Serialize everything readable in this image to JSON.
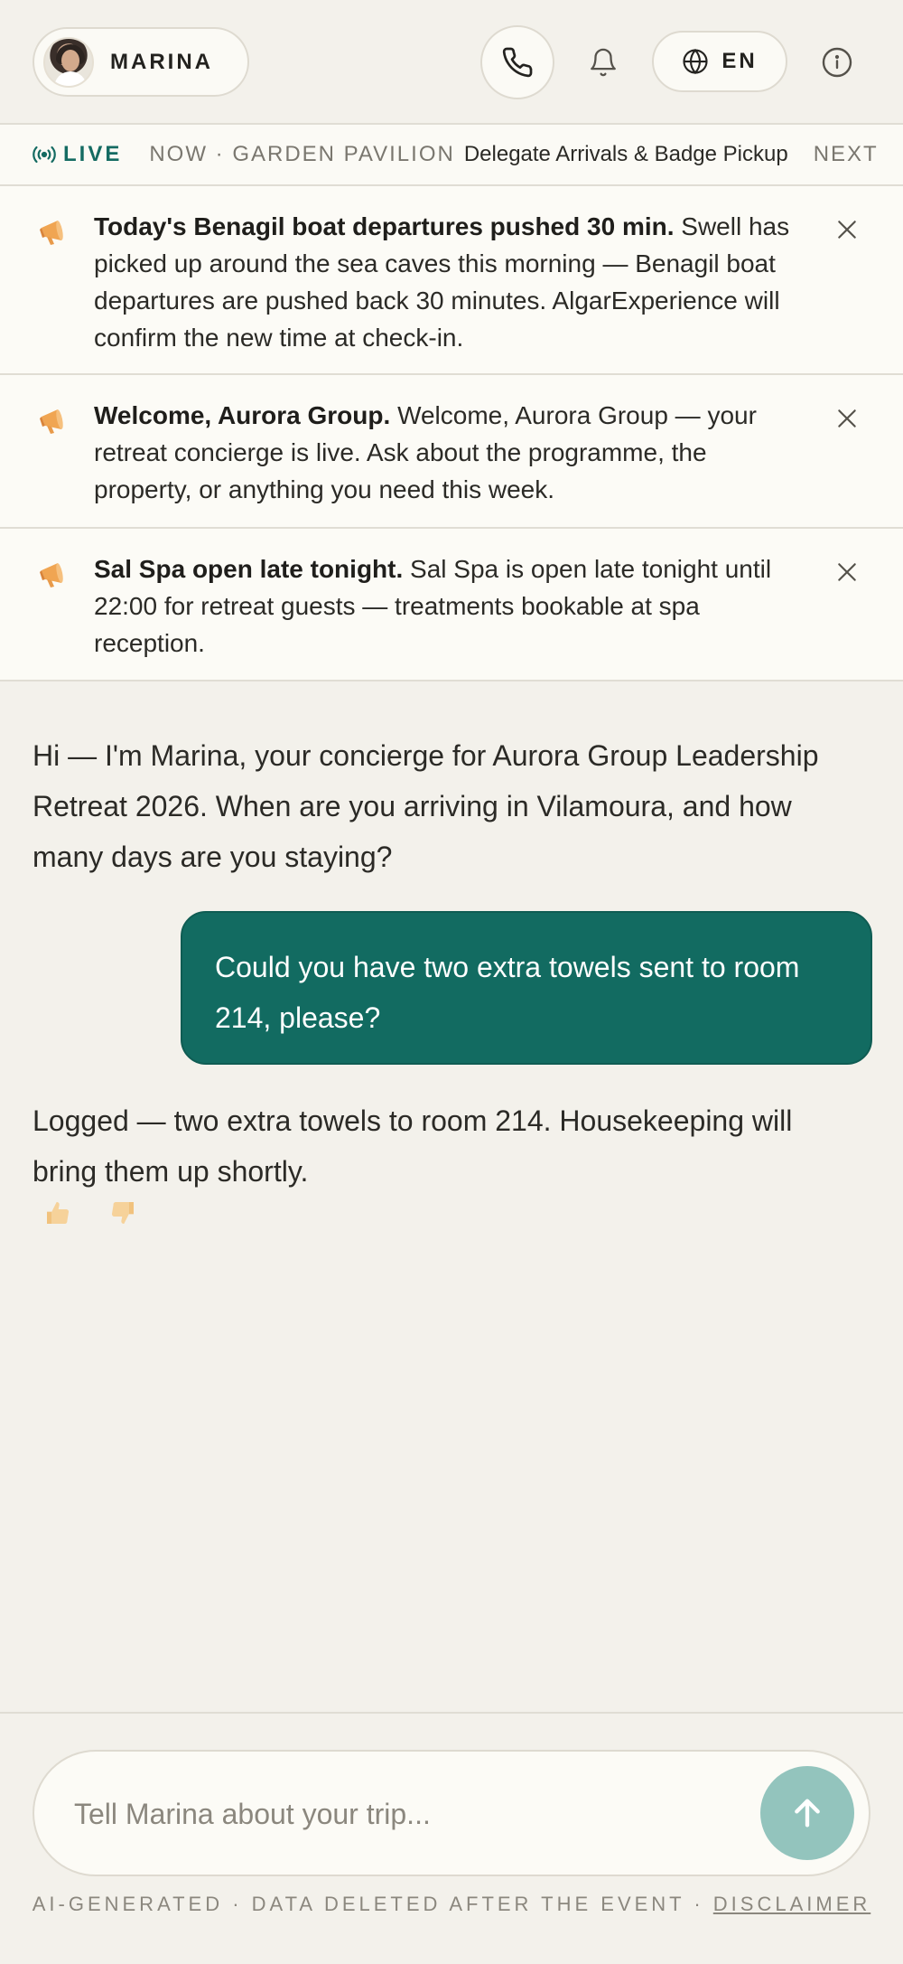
{
  "header": {
    "assistant_name": "MARINA",
    "language": "EN",
    "icons": {
      "phone": "phone-icon",
      "bell": "bell-icon",
      "globe": "globe-icon",
      "info": "info-icon"
    }
  },
  "ticker": {
    "live_label": "LIVE",
    "when": "NOW · GARDEN PAVILION",
    "event": "Delegate Arrivals & Badge Pickup",
    "next_label": "NEXT"
  },
  "announcements": [
    {
      "title": "Today's Benagil boat departures pushed 30 min.",
      "body": "Swell has picked up around the sea caves this morning — Benagil boat departures are pushed back 30 minutes. AlgarExperience will confirm the new time at check-in."
    },
    {
      "title": "Welcome, Aurora Group.",
      "body": "Welcome, Aurora Group — your retreat concierge is live. Ask about the programme, the property, or anything you need this week."
    },
    {
      "title": "Sal Spa open late tonight.",
      "body": "Sal Spa is open late tonight until 22:00 for retreat guests — treatments bookable at spa reception."
    }
  ],
  "chat": {
    "greeting": "Hi — I'm Marina, your concierge for Aurora Group Leadership Retreat 2026. When are you arriving in Vilamoura, and how many days are you staying?",
    "user_message": "Could you have two extra towels sent to room 214, please?",
    "reply": "Logged — two extra towels to room 214. Housekeeping will bring them up shortly."
  },
  "composer": {
    "placeholder": "Tell Marina about your trip..."
  },
  "footer": {
    "note": "AI-GENERATED · DATA DELETED AFTER THE EVENT · ",
    "link": "DISCLAIMER"
  },
  "colors": {
    "accent": "#126b61",
    "send_button": "#93c4bd",
    "background": "#f3f1eb"
  }
}
